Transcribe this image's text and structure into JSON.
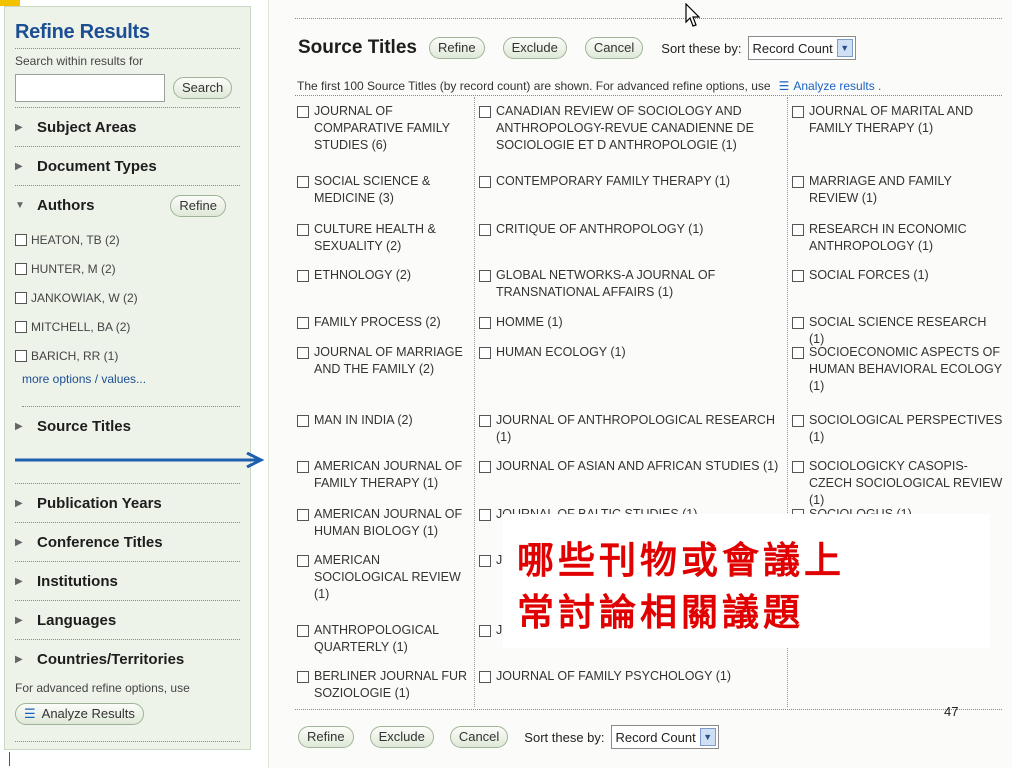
{
  "sidebar": {
    "title": "Refine Results",
    "search_label": "Search within results for",
    "search_value": "",
    "search_button": "Search",
    "sections_top": [
      {
        "label": "Subject Areas"
      },
      {
        "label": "Document Types"
      }
    ],
    "authors": {
      "label": "Authors",
      "refine_button": "Refine",
      "items": [
        "HEATON, TB (2)",
        "HUNTER, M (2)",
        "JANKOWIAK, W (2)",
        "MITCHELL, BA (2)",
        "BARICH, RR (1)"
      ],
      "more_link": "more options / values..."
    },
    "source_titles_label": "Source Titles",
    "sections_bottom": [
      {
        "label": "Publication Years"
      },
      {
        "label": "Conference Titles"
      },
      {
        "label": "Institutions"
      },
      {
        "label": "Languages"
      },
      {
        "label": "Countries/Territories"
      }
    ],
    "advanced_text": "For advanced refine options, use",
    "analyze_button": "Analyze Results"
  },
  "main": {
    "title": "Source Titles",
    "refine_button": "Refine",
    "exclude_button": "Exclude",
    "cancel_button": "Cancel",
    "sort_label": "Sort these by:",
    "sort_value": "Record Count",
    "note": "The first 100 Source Titles (by record count) are shown. For advanced refine options, use",
    "analyze_link": "Analyze results .",
    "col1": [
      "JOURNAL OF COMPARATIVE FAMILY STUDIES (6)",
      "SOCIAL SCIENCE & MEDICINE (3)",
      "CULTURE HEALTH & SEXUALITY (2)",
      "ETHNOLOGY (2)",
      "FAMILY PROCESS (2)",
      "JOURNAL OF MARRIAGE AND THE FAMILY (2)",
      "MAN IN INDIA (2)",
      "AMERICAN JOURNAL OF FAMILY THERAPY (1)",
      "AMERICAN JOURNAL OF HUMAN BIOLOGY (1)",
      "AMERICAN SOCIOLOGICAL REVIEW (1)",
      "ANTHROPOLOGICAL QUARTERLY (1)",
      "BERLINER JOURNAL FUR SOZIOLOGIE (1)"
    ],
    "col2": [
      "CANADIAN REVIEW OF SOCIOLOGY AND ANTHROPOLOGY-REVUE CANADIENNE DE SOCIOLOGIE ET D ANTHROPOLOGIE (1)",
      "CONTEMPORARY FAMILY THERAPY (1)",
      "CRITIQUE OF ANTHROPOLOGY (1)",
      "GLOBAL NETWORKS-A JOURNAL OF TRANSNATIONAL AFFAIRS (1)",
      "HOMME (1)",
      "HUMAN ECOLOGY (1)",
      "JOURNAL OF ANTHROPOLOGICAL RESEARCH (1)",
      "JOURNAL OF ASIAN AND AFRICAN STUDIES (1)",
      "JOURNAL OF BALTIC STUDIES (1)",
      "J",
      "J",
      "JOURNAL OF FAMILY PSYCHOLOGY (1)"
    ],
    "col3": [
      "JOURNAL OF MARITAL AND FAMILY THERAPY (1)",
      "MARRIAGE AND FAMILY REVIEW (1)",
      "RESEARCH IN ECONOMIC ANTHROPOLOGY (1)",
      "SOCIAL FORCES (1)",
      "SOCIAL SCIENCE RESEARCH (1)",
      "SOCIOECONOMIC ASPECTS OF HUMAN BEHAVIORAL ECOLOGY (1)",
      "SOCIOLOGICAL PERSPECTIVES (1)",
      "SOCIOLOGICKY CASOPIS-CZECH SOCIOLOGICAL REVIEW (1)",
      "SOCIOLOGUS (1)"
    ],
    "bottom": {
      "refine_button": "Refine",
      "exclude_button": "Exclude",
      "cancel_button": "Cancel",
      "sort_label": "Sort these by:",
      "sort_value": "Record Count"
    }
  },
  "overlay": {
    "text": "哪些刊物或會議上\n常討論相關議題"
  },
  "page_number": "47",
  "colors": {
    "accent_blue": "#1b4e92",
    "overlay_red": "#e00000",
    "sidebar_bg": "#eef3ea"
  }
}
